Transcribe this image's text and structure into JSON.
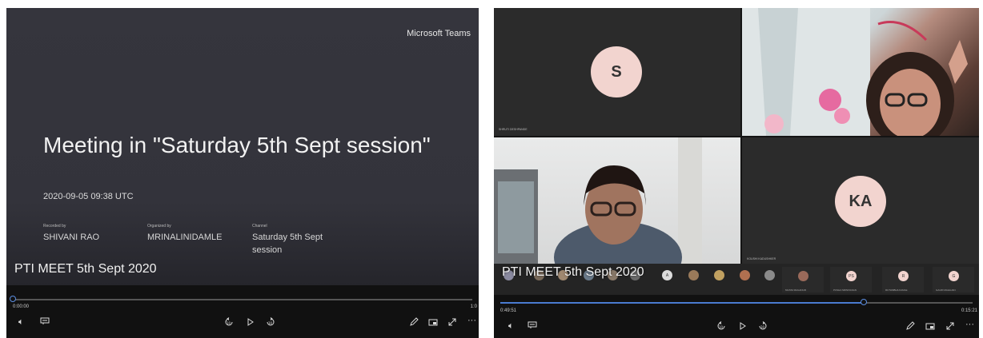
{
  "player1": {
    "brand": "Microsoft Teams",
    "meeting_title": "Meeting in \"Saturday 5th Sept session\"",
    "datetime": "2020-09-05 09:38 UTC",
    "recorded_by_caption": "Recorded by",
    "recorded_by": "SHIVANI RAO",
    "organized_by_caption": "Organized by",
    "organized_by": "MRINALINIDAMLE",
    "channel_caption": "Channel",
    "channel": "Saturday 5th Sept session",
    "recording_title": "PTI MEET 5th Sept 2020",
    "current_time": "0:00:00",
    "duration_partial": "1:0",
    "progress": 0.0
  },
  "player2": {
    "recording_title": "PTI MEET 5th Sept 2020",
    "current_time": "0:49:51",
    "duration": "0:15:21",
    "progress": 0.77,
    "tiles": {
      "s_initial": "S",
      "s_name": "SHRUTI DESHPANDE",
      "ka_initial": "KA",
      "ka_name": "KOUSHI KADUSHKER"
    },
    "strip": {
      "initials": [
        "A",
        "PS",
        "R",
        "G"
      ],
      "names": [
        "MUNNI MAGANUR",
        "PUSHA SRINIVASAN",
        "RUTAMBHA KAMLE",
        "GAURI MAHAJAN"
      ]
    }
  },
  "icons": {
    "volume": "volume-icon",
    "captions": "captions-icon",
    "skip_back": "skip-back-10-icon",
    "play": "play-icon",
    "skip_forward": "skip-forward-30-icon",
    "pen": "pen-icon",
    "theater": "theater-mode-icon",
    "fullscreen": "fullscreen-icon",
    "more": "more-icon"
  },
  "colors": {
    "accent": "#4a7bd0",
    "avatar_bg": "#f2d4cf",
    "splash_bg": "#35353d"
  }
}
